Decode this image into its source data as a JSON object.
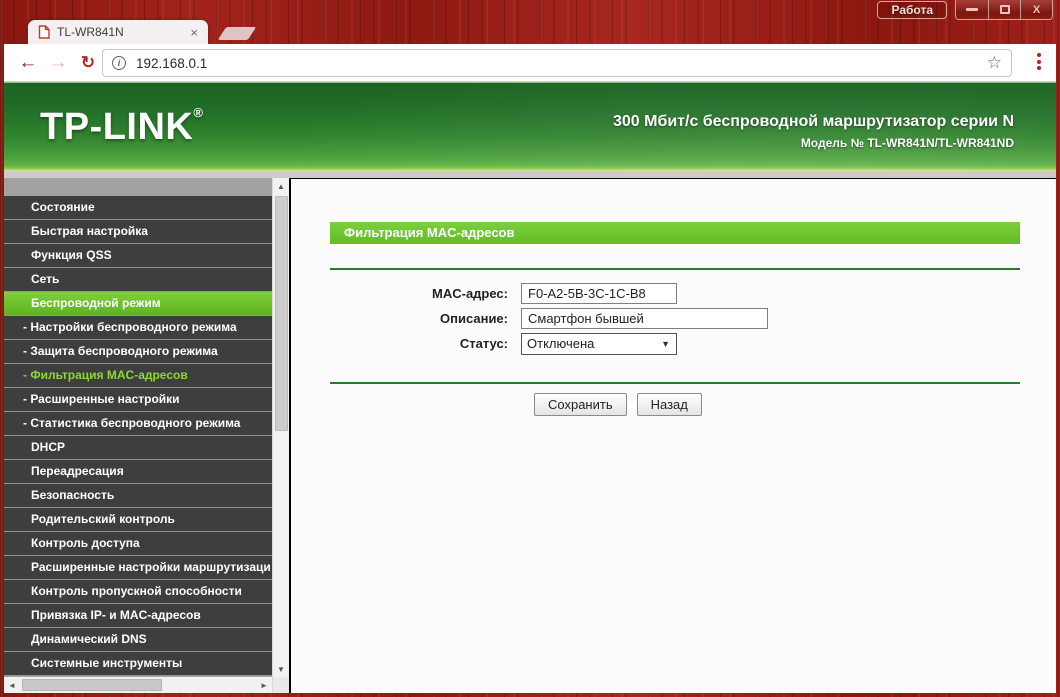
{
  "window": {
    "profile_label": "Работа",
    "controls": {
      "minimize": "minimize",
      "maximize": "maximize",
      "close_glyph": "x"
    }
  },
  "browser": {
    "tab": {
      "title": "TL-WR841N",
      "close_glyph": "×"
    },
    "toolbar": {
      "back_glyph": "←",
      "forward_glyph": "→",
      "reload_glyph": "↻",
      "info_glyph": "i",
      "url": "192.168.0.1",
      "star_glyph": "☆"
    }
  },
  "header": {
    "logo_text": "TP-LINK",
    "registered_mark": "®",
    "tagline": "300 Мбит/с беспроводной маршрутизатор серии N",
    "model_line": "Модель № TL-WR841N/TL-WR841ND"
  },
  "sidebar": {
    "items": [
      {
        "label": "Состояние"
      },
      {
        "label": "Быстрая настройка"
      },
      {
        "label": "Функция QSS"
      },
      {
        "label": "Сеть"
      },
      {
        "label": "Беспроводной режим",
        "state": "active"
      },
      {
        "label": "- Настройки беспроводного режима",
        "sub": true
      },
      {
        "label": "- Защита беспроводного режима",
        "sub": true
      },
      {
        "label": "- Фильтрация MAC-адресов",
        "sub": true,
        "state": "selected"
      },
      {
        "label": "- Расширенные настройки",
        "sub": true
      },
      {
        "label": "- Статистика беспроводного режима",
        "sub": true
      },
      {
        "label": "DHCP"
      },
      {
        "label": "Переадресация"
      },
      {
        "label": "Безопасность"
      },
      {
        "label": "Родительский контроль"
      },
      {
        "label": "Контроль доступа"
      },
      {
        "label": "Расширенные настройки маршрутизаци"
      },
      {
        "label": "Контроль пропускной способности"
      },
      {
        "label": "Привязка IP- и MAC-адресов"
      },
      {
        "label": "Динамический DNS"
      },
      {
        "label": "Системные инструменты"
      }
    ],
    "scroll_glyphs": {
      "up": "▲",
      "down": "▼",
      "left": "◄",
      "right": "►"
    }
  },
  "main": {
    "section_title": "Фильтрация MAC-адресов",
    "form": {
      "mac": {
        "label": "MAC-адрес:",
        "value": "F0-A2-5B-3C-1C-B8"
      },
      "description": {
        "label": "Описание:",
        "value": "Смартфон бывшей"
      },
      "status": {
        "label": "Статус:",
        "value": "Отключена",
        "arrow_glyph": "▼"
      },
      "save_label": "Сохранить",
      "back_label": "Назад"
    }
  },
  "colors": {
    "accent_green": "#62bd22",
    "dark_green_line": "#2a7c2a",
    "active_sub_text": "#8ed832",
    "sidebar_item_bg": "#3e3e3e",
    "chrome_red": "#951d15"
  }
}
